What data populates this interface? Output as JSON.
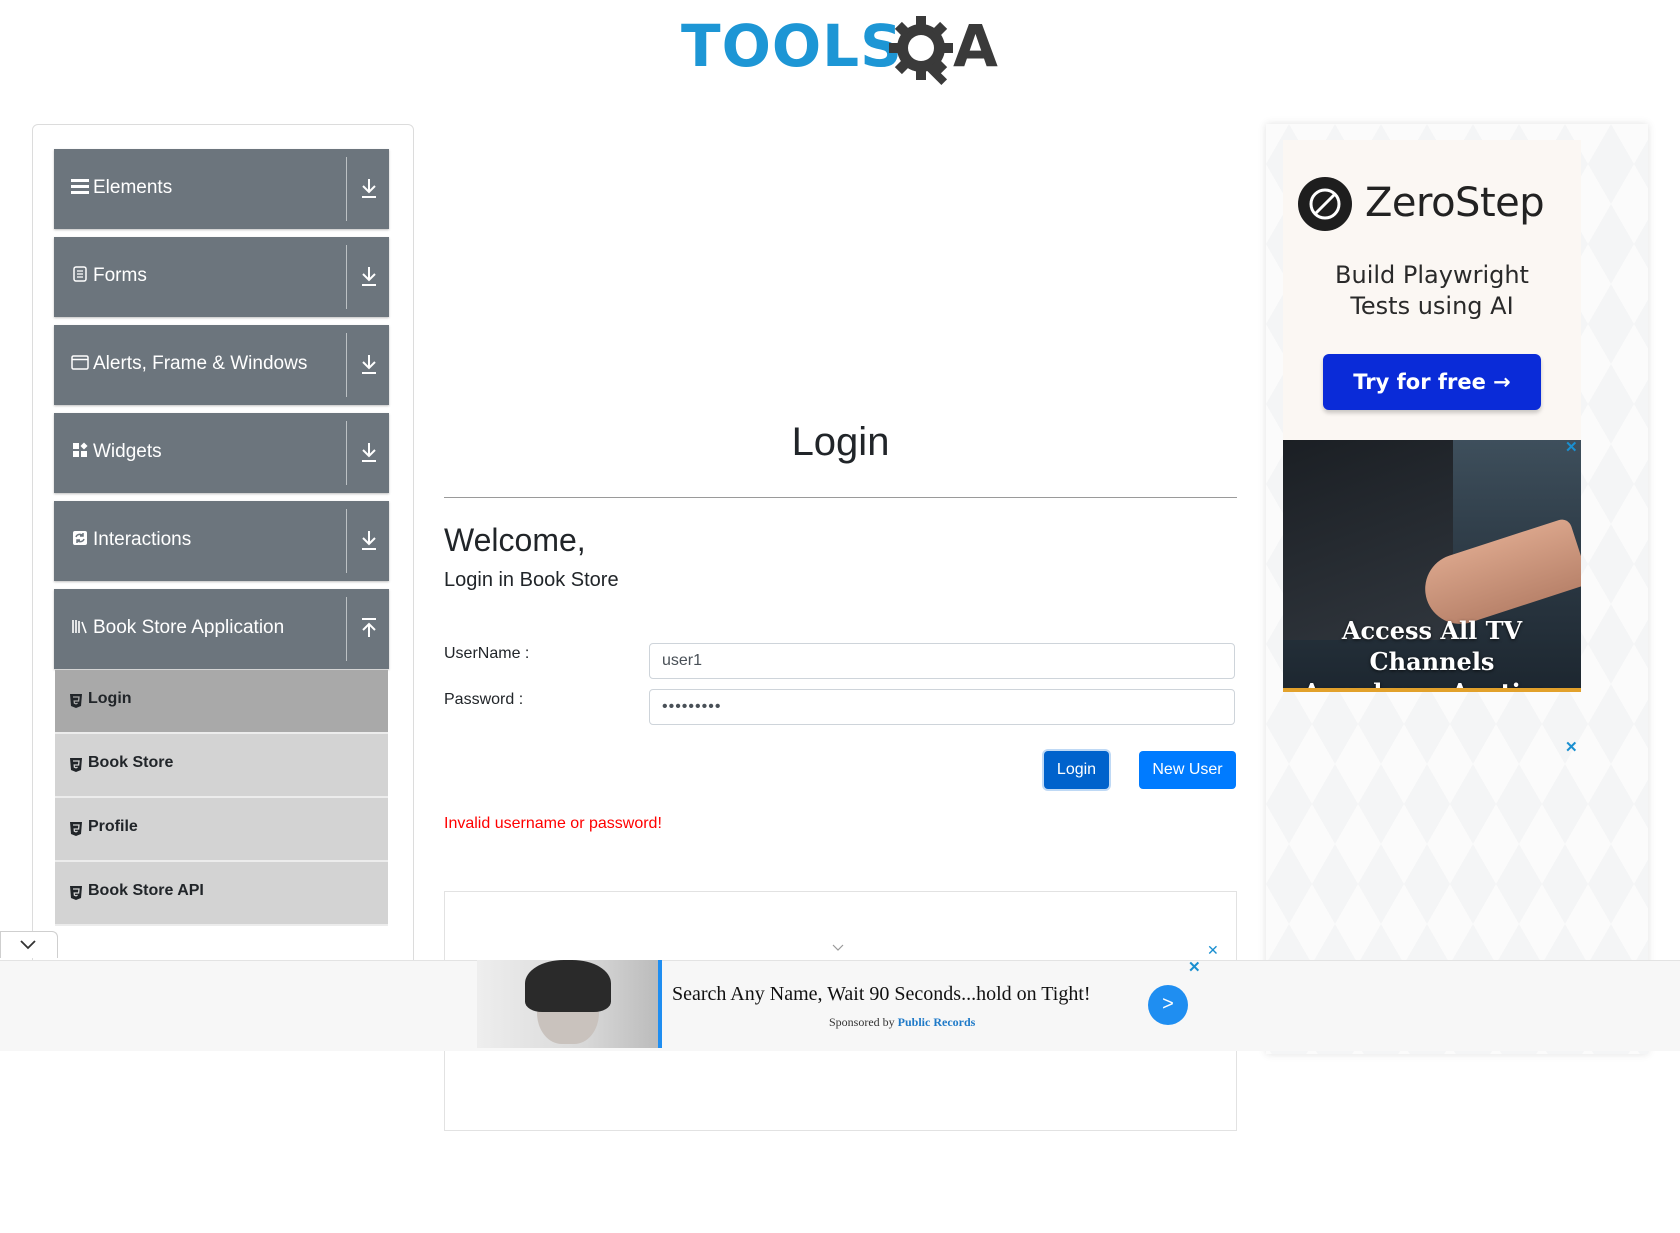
{
  "logo": {
    "tools": "TOOLS",
    "qa": "A"
  },
  "sidebar": {
    "groups": [
      {
        "label": "Elements",
        "icon": "hamburger-icon",
        "toggle": "download-arrow-icon"
      },
      {
        "label": "Forms",
        "icon": "form-doc-icon",
        "toggle": "download-arrow-icon"
      },
      {
        "label": "Alerts, Frame & Windows",
        "icon": "window-icon",
        "toggle": "download-arrow-icon"
      },
      {
        "label": "Widgets",
        "icon": "widgets-icon",
        "toggle": "download-arrow-icon"
      },
      {
        "label": "Interactions",
        "icon": "interactions-icon",
        "toggle": "download-arrow-icon"
      },
      {
        "label": "Book Store Application",
        "icon": "books-icon",
        "toggle": "upload-arrow-icon"
      }
    ],
    "book_store_items": [
      {
        "label": "Login",
        "active": true
      },
      {
        "label": "Book Store",
        "active": false
      },
      {
        "label": "Profile",
        "active": false
      },
      {
        "label": "Book Store API",
        "active": false
      }
    ]
  },
  "main": {
    "title": "Login",
    "welcome": "Welcome,",
    "subtitle": "Login in Book Store",
    "username_label": "UserName :",
    "username_value": "user1",
    "password_label": "Password :",
    "password_value": "•••••••••",
    "login_button": "Login",
    "new_user_button": "New User",
    "error": "Invalid username or password!"
  },
  "ads": {
    "zerostep": {
      "name": "ZeroStep",
      "headline_1": "Build Playwright",
      "headline_2": "Tests using AI",
      "cta": "Try for free →"
    },
    "tv": {
      "line_1": "Access All TV Channels",
      "line_2": "Anywhere, Anytime"
    },
    "bottom": {
      "headline": "Search Any Name, Wait 90 Seconds...hold on Tight!",
      "sponsored_by": "Sponsored by",
      "sponsor": "Public Records",
      "go": ">"
    },
    "close": "✕"
  },
  "colors": {
    "brand_blue": "#1d96d5",
    "sidebar_group": "#6c757d",
    "primary": "#007bff",
    "error": "#ff0000"
  }
}
